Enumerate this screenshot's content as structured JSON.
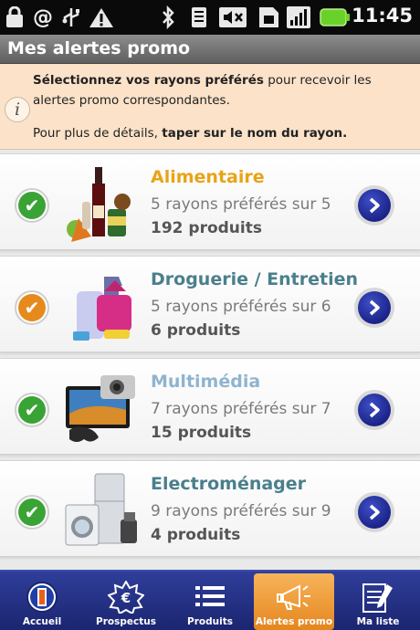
{
  "status_bar": {
    "time": "11:45",
    "icons": [
      "lock-icon",
      "at-icon",
      "usb-icon",
      "warning-icon",
      "bluetooth-icon",
      "wifi-icon",
      "mute-icon",
      "sim-icon",
      "signal-icon",
      "battery-icon"
    ]
  },
  "header": {
    "title": "Mes alertes promo"
  },
  "info": {
    "line1_bold": "Sélectionnez vos rayons préférés",
    "line1_rest": " pour recevoir les",
    "line2": "alertes promo correspondantes.",
    "line3_prefix": "Pour plus de détails, ",
    "line3_bold": "taper sur le nom du rayon."
  },
  "categories": [
    {
      "name": "Alimentaire",
      "name_color": "#e8a417",
      "subtitle": "5 rayons préférés sur 5",
      "count": "192 produits",
      "check_color": "#3aa335",
      "icon": "groceries-icon"
    },
    {
      "name": "Droguerie / Entretien",
      "name_color": "#4a7f8c",
      "subtitle": "5 rayons préférés sur 6",
      "count": "6 produits",
      "check_color": "#e68a1e",
      "icon": "cleaning-products-icon"
    },
    {
      "name": "Multimédia",
      "name_color": "#8fb4cf",
      "subtitle": "7 rayons préférés sur 7",
      "count": "15 produits",
      "check_color": "#3aa335",
      "icon": "multimedia-icon"
    },
    {
      "name": "Electroménager",
      "name_color": "#4a7f8c",
      "subtitle": "9 rayons préférés sur 9",
      "count": "4 produits",
      "check_color": "#3aa335",
      "icon": "appliances-icon"
    }
  ],
  "nav": {
    "tabs": [
      {
        "label": "Accueil",
        "icon": "home-logo-icon",
        "active": false
      },
      {
        "label": "Prospectus",
        "icon": "euro-badge-icon",
        "active": false
      },
      {
        "label": "Produits",
        "icon": "list-icon",
        "active": false
      },
      {
        "label": "Alertes promo",
        "icon": "megaphone-icon",
        "active": true
      },
      {
        "label": "Ma liste",
        "icon": "notepad-icon",
        "active": false
      }
    ]
  }
}
